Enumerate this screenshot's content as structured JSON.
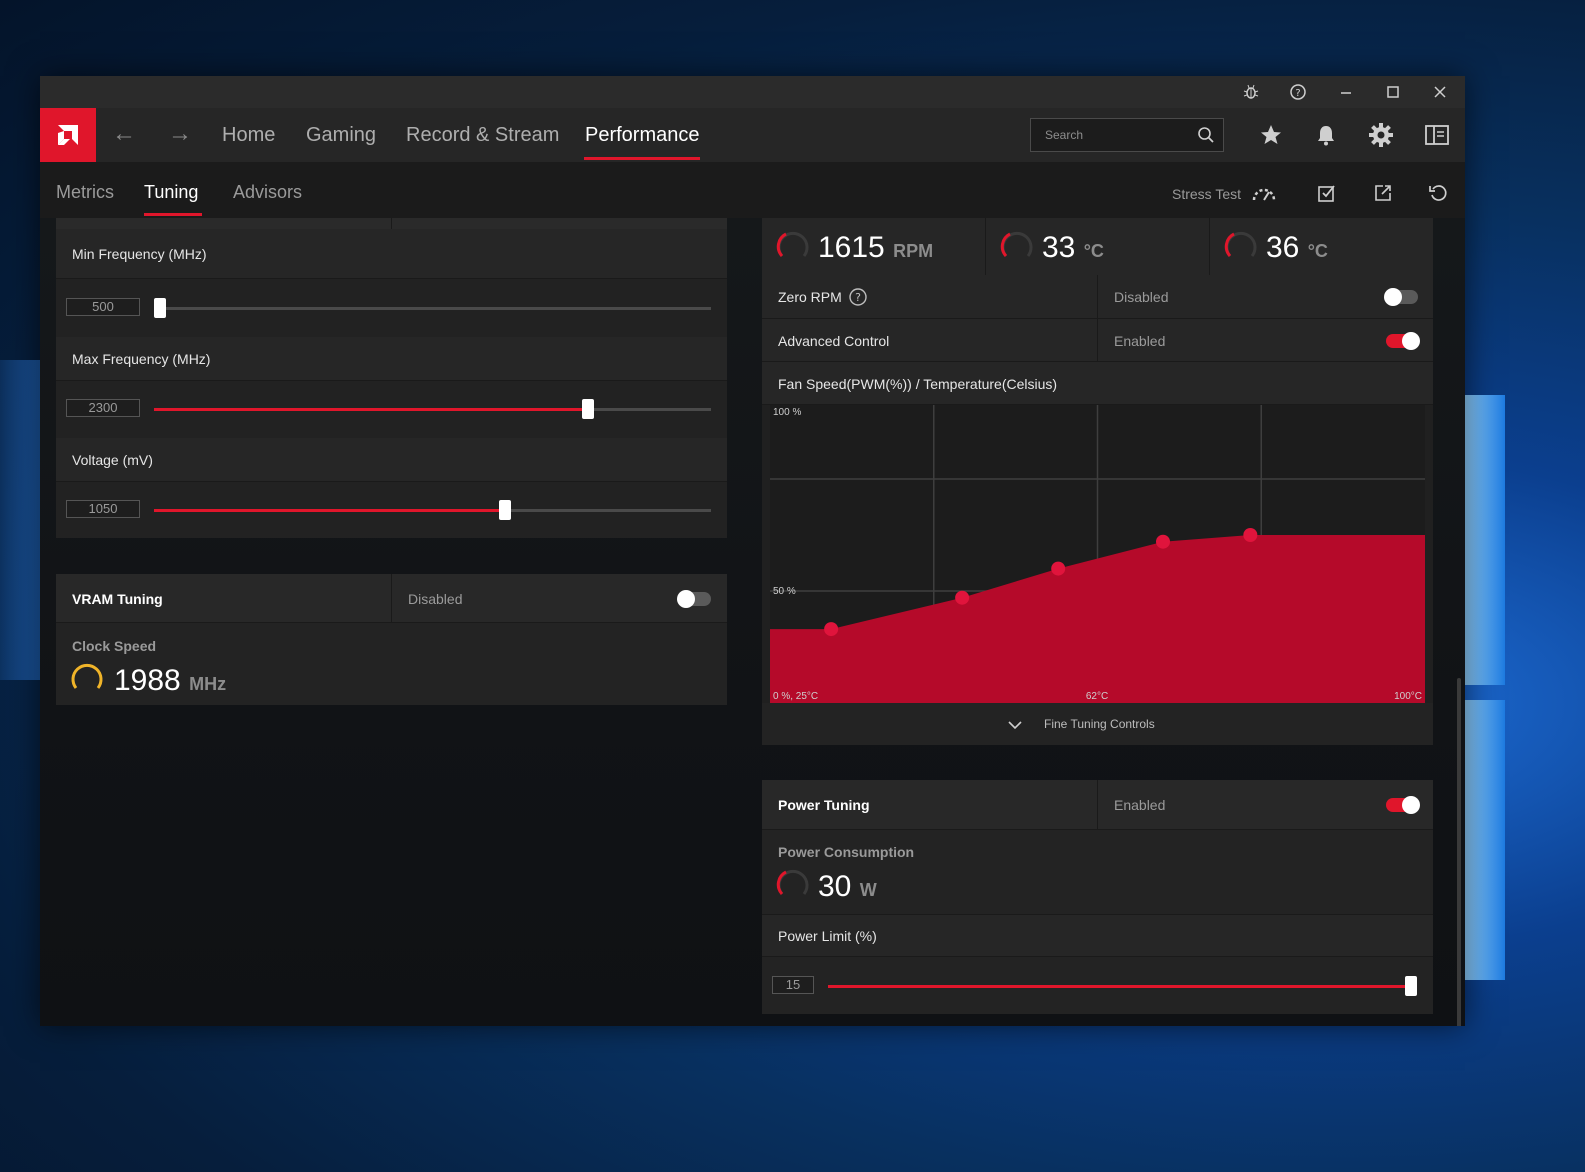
{
  "window": {
    "title_icons": [
      "bug-icon",
      "help-icon",
      "minimize-icon",
      "maximize-icon",
      "close-icon"
    ]
  },
  "nav": {
    "links": [
      "Home",
      "Gaming",
      "Record & Stream",
      "Performance"
    ],
    "active": "Performance",
    "search_placeholder": "Search"
  },
  "subnav": {
    "tabs": [
      "Metrics",
      "Tuning",
      "Advisors"
    ],
    "active": "Tuning",
    "stress_test_label": "Stress Test"
  },
  "gpu_tuning": {
    "min_frequency": {
      "label": "Min Frequency (MHz)",
      "value": "500",
      "fraction": 0.0
    },
    "max_frequency": {
      "label": "Max Frequency (MHz)",
      "value": "2300",
      "fraction": 0.78
    },
    "voltage": {
      "label": "Voltage (mV)",
      "value": "1050",
      "fraction": 0.63
    }
  },
  "vram_tuning": {
    "title": "VRAM Tuning",
    "state": "Disabled",
    "enabled": false,
    "clock_speed_label": "Clock Speed",
    "clock_speed_value": "1988",
    "clock_speed_unit": "MHz"
  },
  "fan_tuning": {
    "readouts": [
      {
        "value": "1615",
        "unit": "RPM"
      },
      {
        "value": "33",
        "unit": "°C"
      },
      {
        "value": "36",
        "unit": "°C"
      }
    ],
    "zero_rpm": {
      "label": "Zero RPM",
      "state": "Disabled",
      "enabled": false
    },
    "advanced_control": {
      "label": "Advanced Control",
      "state": "Enabled",
      "enabled": true
    },
    "fine_tuning_label": "Fine Tuning Controls"
  },
  "chart_data": {
    "type": "area",
    "title": "Fan Speed(PWM(%)) / Temperature(Celsius)",
    "y_tick_labels": [
      "100 %",
      "50 %"
    ],
    "x_tick_labels": [
      "0 %, 25°C",
      "62°C",
      "100°C"
    ],
    "xlim": [
      25,
      100
    ],
    "ylim": [
      0,
      100
    ],
    "points": [
      {
        "x": 32,
        "y": 33
      },
      {
        "x": 47,
        "y": 47
      },
      {
        "x": 58,
        "y": 60
      },
      {
        "x": 70,
        "y": 72
      },
      {
        "x": 80,
        "y": 75
      }
    ],
    "fill_color": "#b50a2a",
    "point_color": "#e0143c"
  },
  "power_tuning": {
    "title": "Power Tuning",
    "state": "Enabled",
    "enabled": true,
    "consumption_label": "Power Consumption",
    "consumption_value": "30",
    "consumption_unit": "W",
    "limit_label": "Power Limit (%)",
    "limit_value": "15",
    "limit_fraction": 1.0
  },
  "colors": {
    "accent": "#e0162b",
    "gauge_yellow": "#f0b429"
  }
}
